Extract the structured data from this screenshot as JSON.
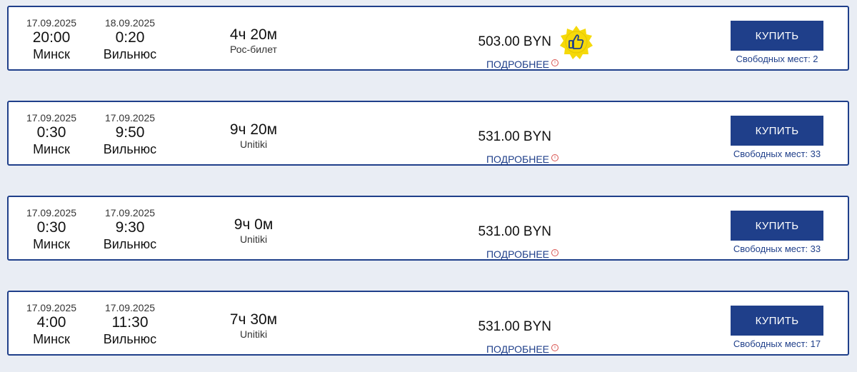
{
  "currency": "BYN",
  "buy_label": "КУПИТЬ",
  "details_label": "ПОДРОБНЕЕ",
  "seats_prefix": "Свободных мест:",
  "icons": {
    "details_info": "info-icon",
    "recommended": "thumbs-up-badge-icon"
  },
  "colors": {
    "accent": "#1f3f8a",
    "badge": "#f5d90a",
    "info": "#d9534f"
  },
  "results": [
    {
      "dep_date": "17.09.2025",
      "dep_time": "20:00",
      "dep_city": "Минск",
      "arr_date": "18.09.2025",
      "arr_time": "0:20",
      "arr_city": "Вильнюс",
      "duration": "4ч 20м",
      "carrier": "Рос-билет",
      "price": "503.00 BYN",
      "seats": "Свободных мест: 2",
      "recommended": true
    },
    {
      "dep_date": "17.09.2025",
      "dep_time": "0:30",
      "dep_city": "Минск",
      "arr_date": "17.09.2025",
      "arr_time": "9:50",
      "arr_city": "Вильнюс",
      "duration": "9ч 20м",
      "carrier": "Unitiki",
      "price": "531.00 BYN",
      "seats": "Свободных мест: 33",
      "recommended": false
    },
    {
      "dep_date": "17.09.2025",
      "dep_time": "0:30",
      "dep_city": "Минск",
      "arr_date": "17.09.2025",
      "arr_time": "9:30",
      "arr_city": "Вильнюс",
      "duration": "9ч 0м",
      "carrier": "Unitiki",
      "price": "531.00 BYN",
      "seats": "Свободных мест: 33",
      "recommended": false
    },
    {
      "dep_date": "17.09.2025",
      "dep_time": "4:00",
      "dep_city": "Минск",
      "arr_date": "17.09.2025",
      "arr_time": "11:30",
      "arr_city": "Вильнюс",
      "duration": "7ч 30м",
      "carrier": "Unitiki",
      "price": "531.00 BYN",
      "seats": "Свободных мест: 17",
      "recommended": false
    }
  ]
}
